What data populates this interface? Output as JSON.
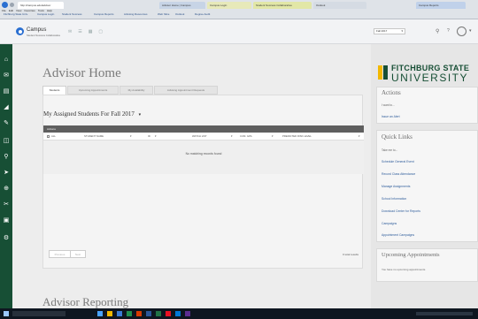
{
  "browser": {
    "tabs": [
      {
        "label": "http://campus.edu/advisor",
        "active": true
      },
      {
        "label": "Advisor Home | Campus",
        "active": false
      },
      {
        "label": "Campus Login",
        "active": false
      },
      {
        "label": "Student Success Collaborative",
        "active": false
      },
      {
        "label": "Outlook",
        "active": false
      },
      {
        "label": "Campus Reports",
        "active": false
      }
    ],
    "menu_items": [
      "File",
      "Edit",
      "View",
      "Favorites",
      "Tools",
      "Help"
    ],
    "bookmarks": [
      "Fitchburg State Univ.",
      "Campus Login",
      "Student Success",
      "Campus Reports",
      "Advising Resources",
      "Web Slice",
      "Outlook",
      "Degree Audit"
    ]
  },
  "header": {
    "logo_title": "Campus",
    "logo_subtitle": "Student Success Collaborative",
    "term_select": "Fall 2017",
    "help_label": "?"
  },
  "page": {
    "title": "Advisor Home",
    "tabs": [
      "Students",
      "Upcoming Appointments",
      "My Availability",
      "Advising Appointment Requests"
    ],
    "section_title": "My Assigned Students For Fall 2017",
    "actions_label": "Actions",
    "table_headers": [
      "ALL",
      "STUDENT NAME",
      "ID",
      "WATCH LIST",
      "CUM. GPA",
      "PREDICTED RISK LEVEL"
    ],
    "empty_message": "No matching records found",
    "pagination": {
      "previous": "Previous",
      "next": "Next"
    },
    "total_results": "0 total results",
    "reporting_title": "Advisor Reporting"
  },
  "right_panel": {
    "brand_line1": "FITCHBURG STATE",
    "brand_line2": "UNIVERSITY",
    "actions_title": "Actions",
    "actions_prompt": "I want to...",
    "actions_link": "Issue an Alert",
    "quick_links_title": "Quick Links",
    "quick_links_prompt": "Take me to...",
    "quick_links": [
      "Schedule General Event",
      "Record Class Attendance",
      "Manage Assignments",
      "School Information",
      "Download Center for Reports",
      "Campaigns",
      "Appointment Campaigns"
    ],
    "upcoming_title": "Upcoming Appointments",
    "upcoming_text": "You have no upcoming appointments."
  },
  "colors": {
    "sidebar": "#174f35",
    "brand_gold": "#f2b800",
    "brand_green": "#174f35",
    "table_header": "#5f5f5f"
  }
}
